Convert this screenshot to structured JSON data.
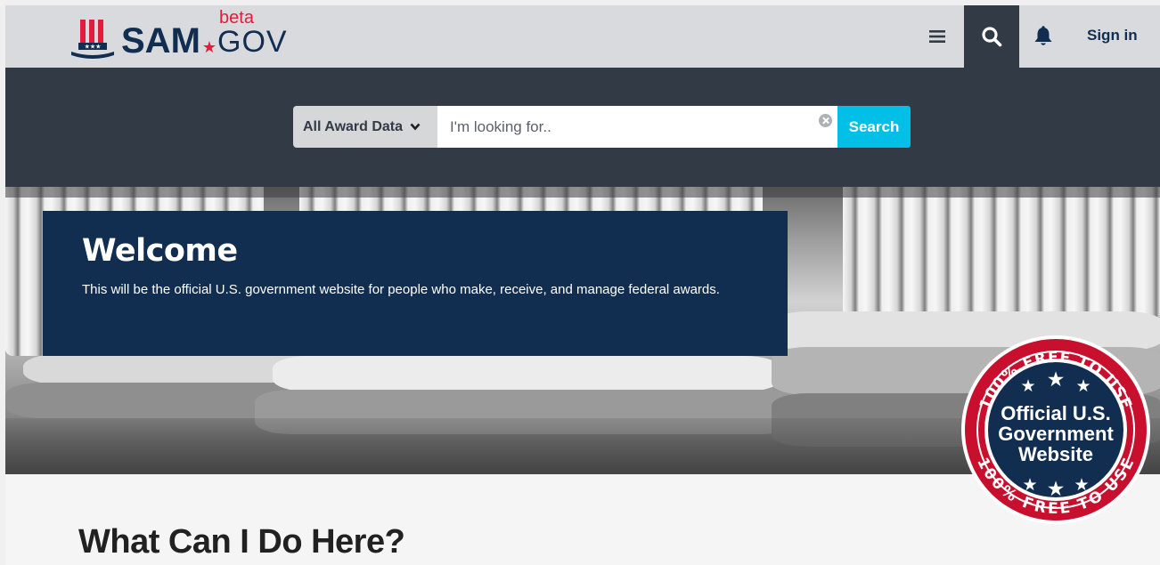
{
  "header": {
    "brand": {
      "name": "SAM",
      "beta": "beta",
      "gov": "GOV"
    },
    "menu_icon": "hamburger-menu-icon",
    "search_icon": "search-icon",
    "bell_icon": "notification-bell-icon",
    "sign_in_label": "Sign in"
  },
  "search": {
    "filter_selected": "All Award Data",
    "placeholder": "I'm looking for..",
    "value": "",
    "button_label": "Search"
  },
  "hero": {
    "title": "Welcome",
    "description": "This will be the official U.S. government website for people who make, receive, and manage federal awards."
  },
  "badge": {
    "top_arc": "100% FREE TO USE",
    "bottom_arc": "100% FREE TO USE",
    "line1": "Official U.S.",
    "line2": "Government",
    "line3": "Website"
  },
  "section": {
    "title": "What Can I Do Here?"
  },
  "colors": {
    "header_bg": "#d8dadd",
    "dark_bg": "#323a45",
    "navy": "#112e51",
    "accent_blue": "#02bfe7",
    "red": "#e31c3d"
  }
}
